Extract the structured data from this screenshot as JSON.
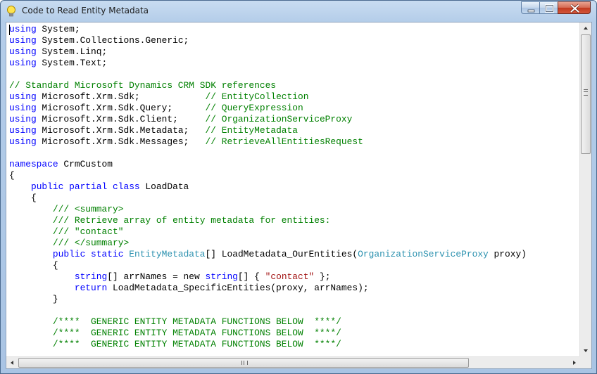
{
  "window": {
    "title": "Code to Read Entity Metadata",
    "icon": "lightbulb-icon",
    "controls": [
      "minimize-icon",
      "maximize-icon",
      "close-icon"
    ]
  },
  "colors": {
    "keyword": "#0000ff",
    "comment": "#008000",
    "type": "#2b91af",
    "string": "#a31515",
    "text": "#000000"
  },
  "code": {
    "lines": [
      [
        {
          "t": "using",
          "c": "kw"
        },
        {
          "t": " System;"
        }
      ],
      [
        {
          "t": "using",
          "c": "kw"
        },
        {
          "t": " System.Collections.Generic;"
        }
      ],
      [
        {
          "t": "using",
          "c": "kw"
        },
        {
          "t": " System.Linq;"
        }
      ],
      [
        {
          "t": "using",
          "c": "kw"
        },
        {
          "t": " System.Text;"
        }
      ],
      [],
      [
        {
          "t": "// Standard Microsoft Dynamics CRM SDK references",
          "c": "cm"
        }
      ],
      [
        {
          "t": "using",
          "c": "kw"
        },
        {
          "t": " Microsoft.Xrm.Sdk;            "
        },
        {
          "t": "// EntityCollection",
          "c": "cm"
        }
      ],
      [
        {
          "t": "using",
          "c": "kw"
        },
        {
          "t": " Microsoft.Xrm.Sdk.Query;      "
        },
        {
          "t": "// QueryExpression",
          "c": "cm"
        }
      ],
      [
        {
          "t": "using",
          "c": "kw"
        },
        {
          "t": " Microsoft.Xrm.Sdk.Client;     "
        },
        {
          "t": "// OrganizationServiceProxy",
          "c": "cm"
        }
      ],
      [
        {
          "t": "using",
          "c": "kw"
        },
        {
          "t": " Microsoft.Xrm.Sdk.Metadata;   "
        },
        {
          "t": "// EntityMetadata",
          "c": "cm"
        }
      ],
      [
        {
          "t": "using",
          "c": "kw"
        },
        {
          "t": " Microsoft.Xrm.Sdk.Messages;   "
        },
        {
          "t": "// RetrieveAllEntitiesRequest",
          "c": "cm"
        }
      ],
      [],
      [
        {
          "t": "namespace",
          "c": "kw"
        },
        {
          "t": " CrmCustom"
        }
      ],
      [
        {
          "t": "{"
        }
      ],
      [
        {
          "t": "    "
        },
        {
          "t": "public partial class",
          "c": "kw"
        },
        {
          "t": " LoadData"
        }
      ],
      [
        {
          "t": "    {"
        }
      ],
      [
        {
          "t": "        /// <summary>",
          "c": "cm"
        }
      ],
      [
        {
          "t": "        /// Retrieve array of entity metadata for entities:",
          "c": "cm"
        }
      ],
      [
        {
          "t": "        /// \"contact\"",
          "c": "cm"
        }
      ],
      [
        {
          "t": "        /// </summary>",
          "c": "cm"
        }
      ],
      [
        {
          "t": "        "
        },
        {
          "t": "public static",
          "c": "kw"
        },
        {
          "t": " "
        },
        {
          "t": "EntityMetadata",
          "c": "ty"
        },
        {
          "t": "[] LoadMetadata_OurEntities("
        },
        {
          "t": "OrganizationServiceProxy",
          "c": "ty"
        },
        {
          "t": " proxy)"
        }
      ],
      [
        {
          "t": "        {"
        }
      ],
      [
        {
          "t": "            "
        },
        {
          "t": "string",
          "c": "kw"
        },
        {
          "t": "[] arrNames = new "
        },
        {
          "t": "string",
          "c": "kw"
        },
        {
          "t": "[] { "
        },
        {
          "t": "\"contact\"",
          "c": "st"
        },
        {
          "t": " };"
        }
      ],
      [
        {
          "t": "            "
        },
        {
          "t": "return",
          "c": "kw"
        },
        {
          "t": " LoadMetadata_SpecificEntities(proxy, arrNames);"
        }
      ],
      [
        {
          "t": "        }"
        }
      ],
      [],
      [
        {
          "t": "        /****  GENERIC ENTITY METADATA FUNCTIONS BELOW  ****/",
          "c": "cm"
        }
      ],
      [
        {
          "t": "        /****  GENERIC ENTITY METADATA FUNCTIONS BELOW  ****/",
          "c": "cm"
        }
      ],
      [
        {
          "t": "        /****  GENERIC ENTITY METADATA FUNCTIONS BELOW  ****/",
          "c": "cm"
        }
      ]
    ]
  },
  "scrollbars": {
    "vertical": {
      "up": "arrow-up-icon",
      "down": "arrow-down-icon"
    },
    "horizontal": {
      "left": "arrow-left-icon",
      "right": "arrow-right-icon"
    }
  }
}
